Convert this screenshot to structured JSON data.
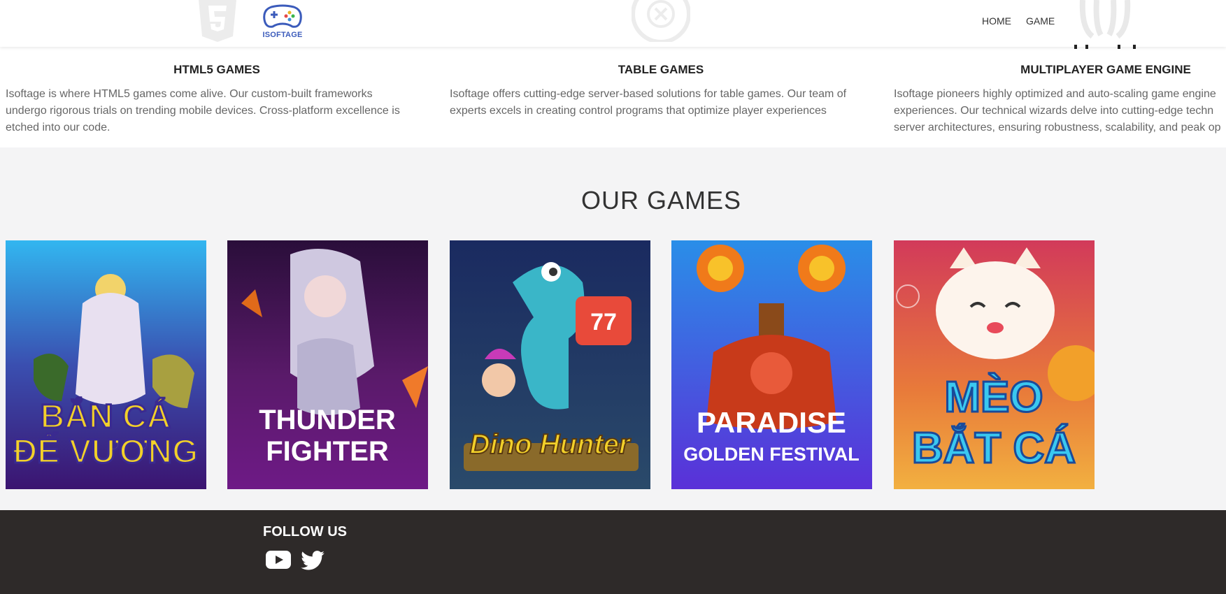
{
  "header": {
    "logo_text": "ISOFTAGE",
    "nav": [
      {
        "label": "HOME"
      },
      {
        "label": "GAME"
      }
    ]
  },
  "features": [
    {
      "title": "HTML5 GAMES",
      "icon": "html5-icon",
      "lines": [
        "Isoftage is where HTML5 games come alive. Our custom-built frameworks",
        "undergo rigorous trials on trending mobile devices. Cross-platform excellence is",
        "etched into our code."
      ]
    },
    {
      "title": "TABLE GAMES",
      "icon": "roulette-icon",
      "lines": [
        "Isoftage offers cutting-edge server-based solutions for table games. Our team of",
        "experts excels in creating control programs that optimize player experiences"
      ]
    },
    {
      "title": "MULTIPLAYER GAME ENGINE",
      "icon": "octopus-icon",
      "lines": [
        "Isoftage pioneers highly optimized and auto-scaling game engine",
        "experiences. Our technical wizards delve into cutting-edge techn",
        "server architectures, ensuring robustness, scalability, and peak op"
      ]
    }
  ],
  "games": {
    "title": "OUR GAMES",
    "cards": [
      {
        "line1": "BẮN CÁ",
        "line2": "ĐẾ VƯƠNG",
        "bg_top": "#2aa7e6",
        "bg_bottom": "#4a1a8a"
      },
      {
        "line1": "THUNDER",
        "line2": "FIGHTER",
        "bg_top": "#3c1352",
        "bg_bottom": "#6a1a8a"
      },
      {
        "line1": "Dino Hunter",
        "line2": "",
        "bg_top": "#1d2a5a",
        "bg_bottom": "#3a5a8a"
      },
      {
        "line1": "PARADISE",
        "line2": "GOLDEN FESTIVAL",
        "bg_top": "#2a7ee0",
        "bg_bottom": "#5a2ad0"
      },
      {
        "line1": "MÈO",
        "line2": "BẮT CÁ",
        "bg_top": "#c9424a",
        "bg_bottom": "#f2a23a"
      }
    ]
  },
  "footer": {
    "follow_title": "FOLLOW US",
    "social": [
      {
        "icon": "youtube-icon"
      },
      {
        "icon": "twitter-icon"
      }
    ]
  }
}
